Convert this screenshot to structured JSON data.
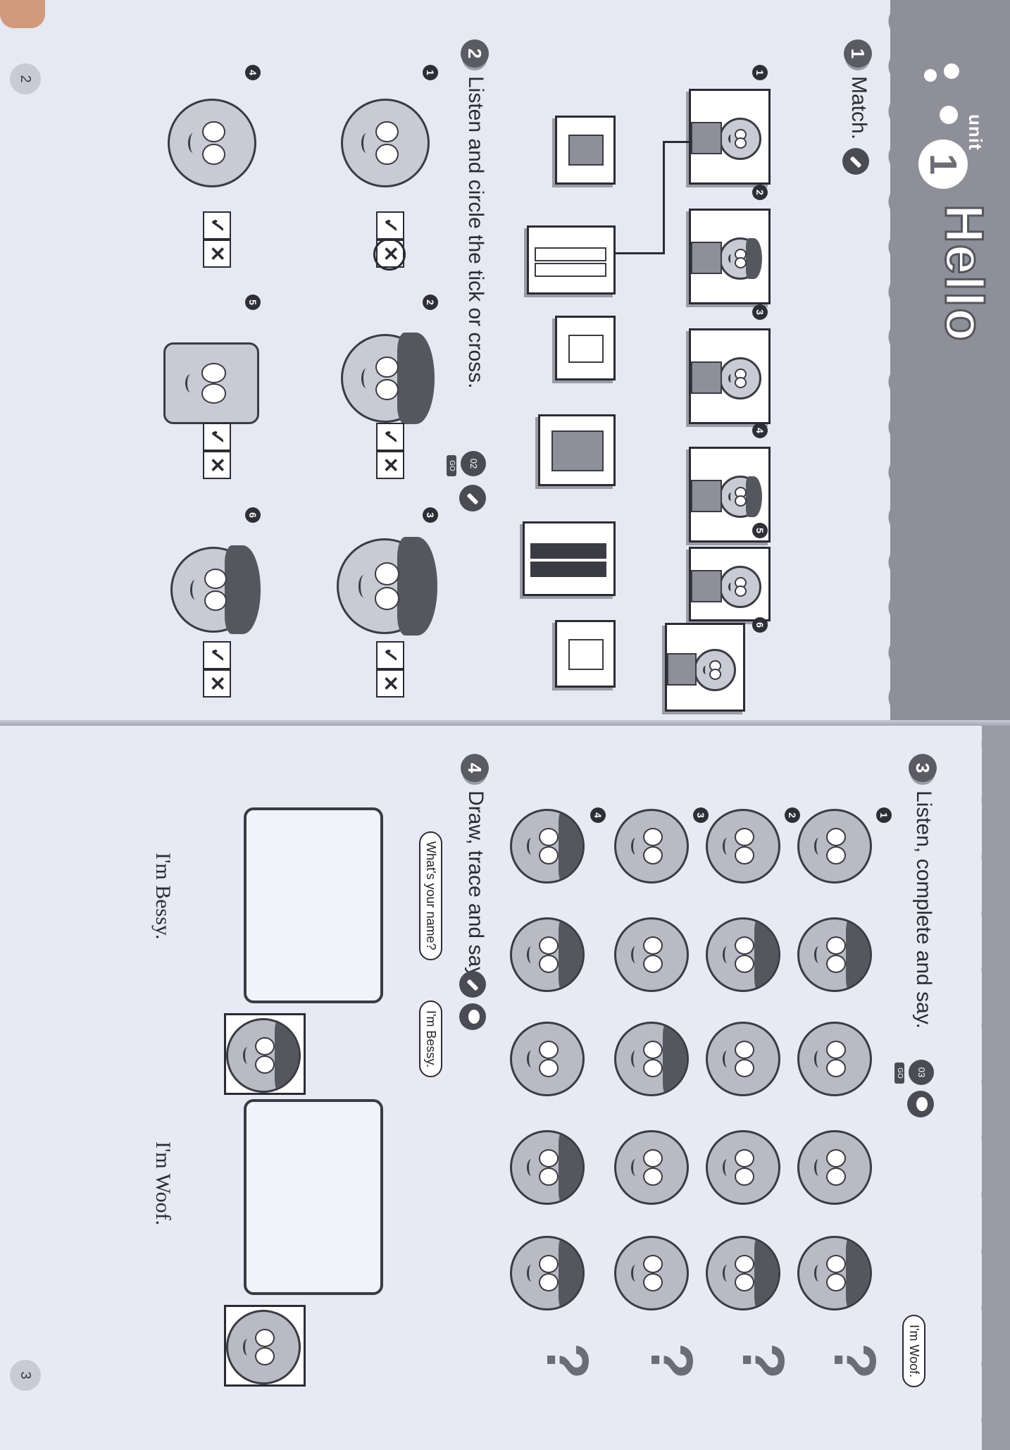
{
  "unit": {
    "word": "unit",
    "number": "1",
    "title": "Hello"
  },
  "exercise1": {
    "number": "1",
    "title": "Match.",
    "items": [
      "1",
      "2",
      "3",
      "4",
      "5",
      "6"
    ]
  },
  "exercise2": {
    "number": "2",
    "title": "Listen and circle the tick or cross.",
    "audio_track": "02",
    "go_tag": "GO",
    "items": [
      "1",
      "2",
      "3",
      "4",
      "5",
      "6"
    ],
    "tick_symbol": "✓",
    "cross_symbol": "✕",
    "answer_circled_item1": "cross"
  },
  "exercise3": {
    "number": "3",
    "title": "Listen, complete and say.",
    "audio_track": "03",
    "go_tag": "GO",
    "items": [
      "1",
      "2",
      "3",
      "4"
    ],
    "speech_bubble": "I'm Woof.",
    "question_mark": "?"
  },
  "exercise4": {
    "number": "4",
    "title": "Draw, trace and say.",
    "bubble_question": "What's your name?",
    "bubble_answer": "I'm Bessy.",
    "trace_bessy": "I'm Bessy.",
    "trace_woof": "I'm Woof."
  },
  "page_numbers": {
    "left": "2",
    "right": "3"
  },
  "colors": {
    "background": "#1fb64a",
    "banner": "#8e8f99",
    "paper": "#e6e8f4"
  }
}
